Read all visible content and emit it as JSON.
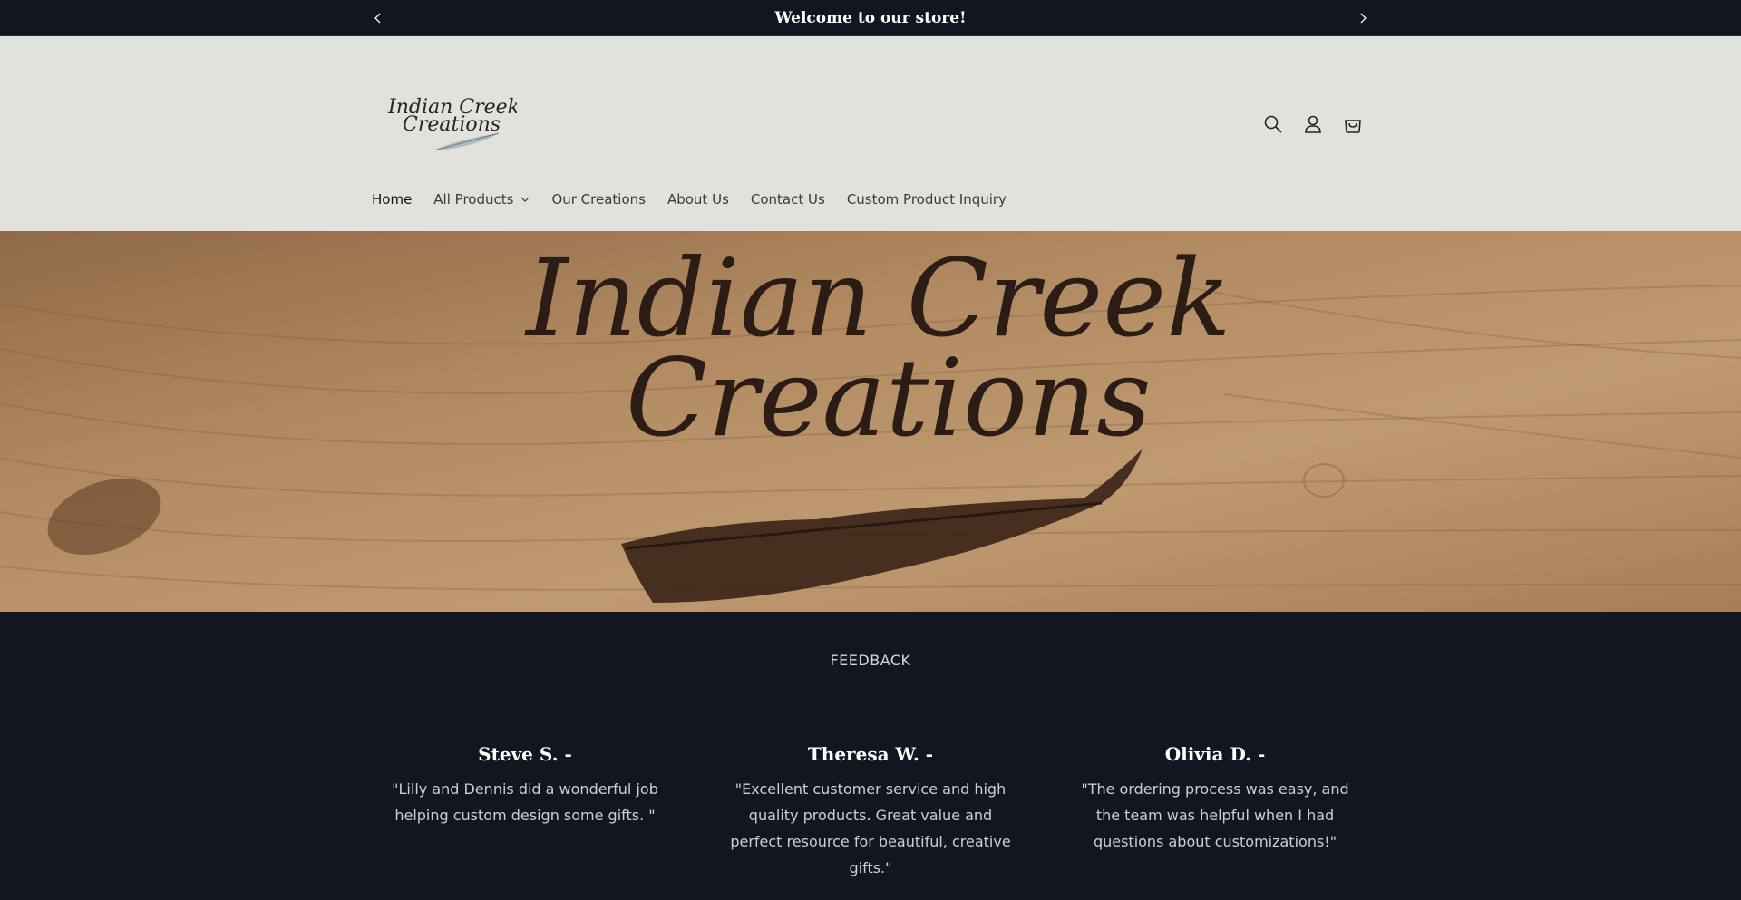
{
  "announcement": {
    "text": "Welcome to our store!",
    "prev_icon": "chevron-left-icon",
    "next_icon": "chevron-right-icon"
  },
  "header": {
    "logo_text_line1": "Indian Creek",
    "logo_text_line2": "Creations",
    "icons": [
      "search-icon",
      "account-icon",
      "cart-icon"
    ]
  },
  "nav": {
    "items": [
      {
        "label": "Home",
        "active": true
      },
      {
        "label": "All Products",
        "has_dropdown": true
      },
      {
        "label": "Our Creations"
      },
      {
        "label": "About Us"
      },
      {
        "label": "Contact Us"
      },
      {
        "label": "Custom Product Inquiry"
      }
    ]
  },
  "hero": {
    "line1": "Indian Creek",
    "line2": "Creations"
  },
  "feedback": {
    "heading": "FEEDBACK",
    "testimonials": [
      {
        "name": "Steve S. -",
        "quote": "\"Lilly and Dennis did a wonderful job helping custom design some gifts. \""
      },
      {
        "name": "Theresa W. -",
        "quote": "\"Excellent customer service and high quality products. Great value and perfect resource for beautiful, creative gifts.\""
      },
      {
        "name": "Olivia D. -",
        "quote": "\"The ordering process was easy, and the team was helpful when I had questions about customizations!\""
      }
    ]
  },
  "colors": {
    "dark_bg": "#121620",
    "header_bg": "#e2e2dc",
    "wood": "#b8916a"
  }
}
